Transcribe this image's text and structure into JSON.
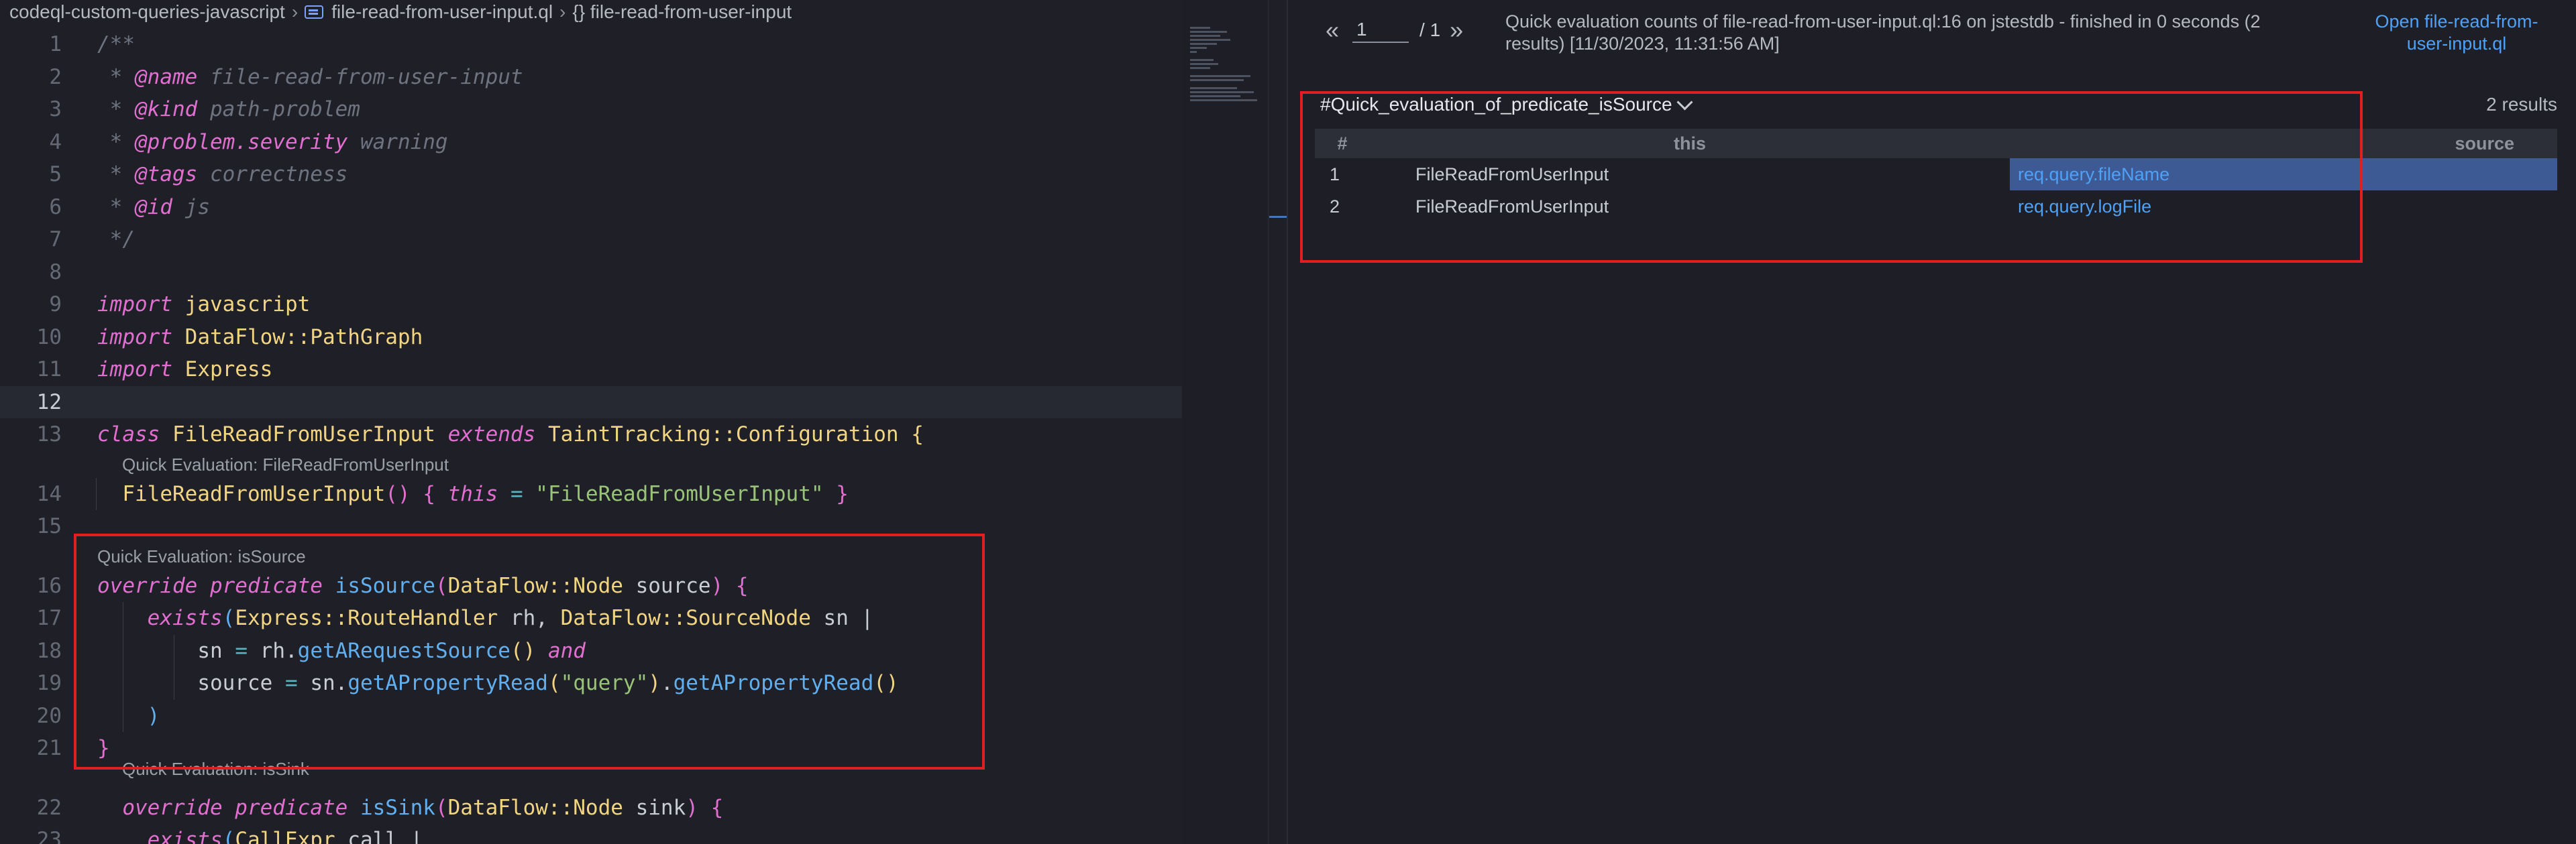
{
  "breadcrumb": {
    "workspace": "codeql-custom-queries-javascript",
    "file": "file-read-from-user-input.ql",
    "symbol": "{} file-read-from-user-input"
  },
  "editor": {
    "line_numbers": [
      "1",
      "2",
      "3",
      "4",
      "5",
      "6",
      "7",
      "8",
      "9",
      "10",
      "11",
      "12",
      "13",
      "14",
      "15",
      "16",
      "17",
      "18",
      "19",
      "20",
      "21",
      "22",
      "23"
    ],
    "code": {
      "l1": "/**",
      "l2_tag": "@name",
      "l2_val": "file-read-from-user-input",
      "l3_tag": "@kind",
      "l3_val": "path-problem",
      "l4_tag": "@problem.severity",
      "l4_val": "warning",
      "l5_tag": "@tags",
      "l5_val": "correctness",
      "l6_tag": "@id",
      "l6_val": "js",
      "l7": "*/",
      "l9_kw": "import",
      "l9_mod": "javascript",
      "l10_kw": "import",
      "l10_mod": "DataFlow::PathGraph",
      "l11_kw": "import",
      "l11_mod": "Express",
      "l13_kw": "class",
      "l13_name": "FileReadFromUserInput",
      "l13_ext": "extends",
      "l13_base": "TaintTracking::Configuration",
      "l13_brace": "{",
      "l14_name": "FileReadFromUserInput",
      "l14_this": "this",
      "l14_str": "\"FileReadFromUserInput\"",
      "l16_kw": "override predicate",
      "l16_fn": "isSource",
      "l16_type": "DataFlow::Node",
      "l16_param": "source",
      "l17_kw": "exists",
      "l17_t1": "Express::RouteHandler",
      "l17_v1": "rh,",
      "l17_t2": "DataFlow::SourceNode",
      "l17_v2": "sn |",
      "l18_v": "sn",
      "l18_obj": "rh.",
      "l18_fn": "getARequestSource",
      "l18_and": "and",
      "l19_v": "source",
      "l19_obj": "sn.",
      "l19_fn1": "getAPropertyRead",
      "l19_str": "\"query\"",
      "l19_fn2": "getAPropertyRead",
      "l22_kw": "override predicate",
      "l22_fn": "isSink",
      "l22_type": "DataFlow::Node",
      "l22_param": "sink",
      "l23_kw": "exists",
      "l23_type": "CallExpr",
      "l23_rest": "call |"
    },
    "code_lens": {
      "l14": "Quick Evaluation: FileReadFromUserInput",
      "l16": "Quick Evaluation: isSource",
      "l22": "Quick Evaluation: isSink"
    }
  },
  "results": {
    "pager": {
      "prev": "«",
      "page": "1",
      "total": "/ 1",
      "next": "»"
    },
    "summary": "Quick evaluation counts of file-read-from-user-input.ql:16 on jstestdb - finished in 0 seconds (2 results) [11/30/2023, 11:31:56 AM]",
    "open_link": "Open file-read-from-user-input.ql",
    "result_set": "#Quick_evaluation_of_predicate_isSource",
    "count": "2 results",
    "columns": [
      "#",
      "this",
      "source"
    ],
    "rows": [
      {
        "num": "1",
        "this": "FileReadFromUserInput",
        "source": "req.query.fileName"
      },
      {
        "num": "2",
        "this": "FileReadFromUserInput",
        "source": "req.query.logFile"
      }
    ]
  },
  "colors": {
    "highlight_box": "#e02020",
    "link": "#4ea1f7",
    "selected_row": "#3e5a94"
  }
}
